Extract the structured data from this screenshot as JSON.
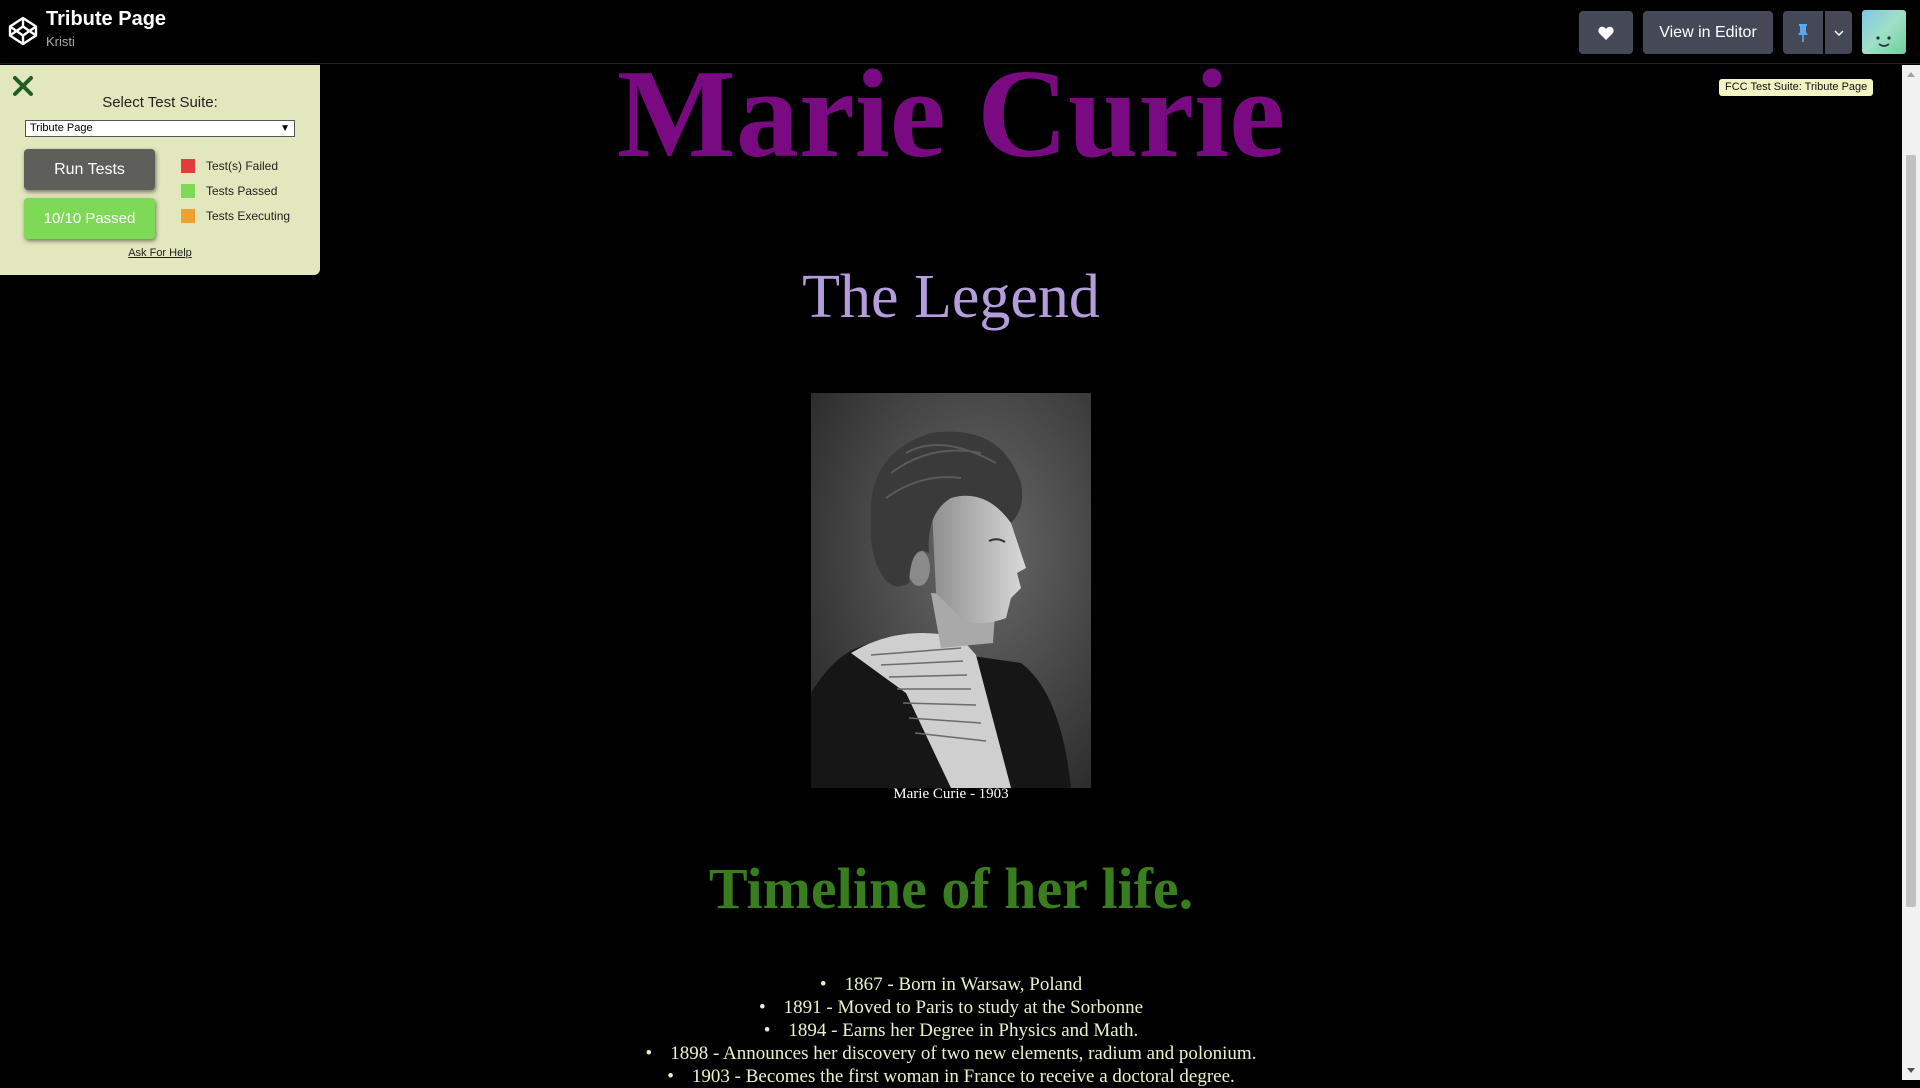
{
  "topbar": {
    "pen_title": "Tribute Page",
    "author": "Kristi",
    "editor_label": "View in Editor",
    "heart_icon": "heart-icon",
    "pin_icon": "pin-icon"
  },
  "test_panel": {
    "select_label": "Select Test Suite:",
    "selected_suite": "Tribute Page",
    "run_label": "Run Tests",
    "passed_label": "10/10 Passed",
    "legend": [
      {
        "label": "Test(s) Failed",
        "color": "#e03c3c"
      },
      {
        "label": "Tests Passed",
        "color": "#7ed957"
      },
      {
        "label": "Tests Executing",
        "color": "#f0a030"
      }
    ],
    "help_label": "Ask For Help"
  },
  "tooltip": "FCC Test Suite: Tribute Page",
  "page": {
    "title": "Marie Curie",
    "subtitle": "The Legend",
    "image_caption": "Marie Curie - 1903",
    "timeline_heading": "Timeline of her life.",
    "timeline": [
      "1867 - Born in Warsaw, Poland",
      "1891 - Moved to Paris to study at the Sorbonne",
      "1894 - Earns her Degree in Physics and Math.",
      "1898 - Announces her discovery of two new elements, radium and polonium.",
      "1903 - Becomes the first woman in France to receive a doctoral degree."
    ]
  },
  "colors": {
    "title": "#7a0a82",
    "subtitle": "#b39ddb",
    "timeline_heading": "#3a7d1e",
    "timeline_text": "#e6f3c8",
    "panel_bg": "#e2e7bd"
  }
}
